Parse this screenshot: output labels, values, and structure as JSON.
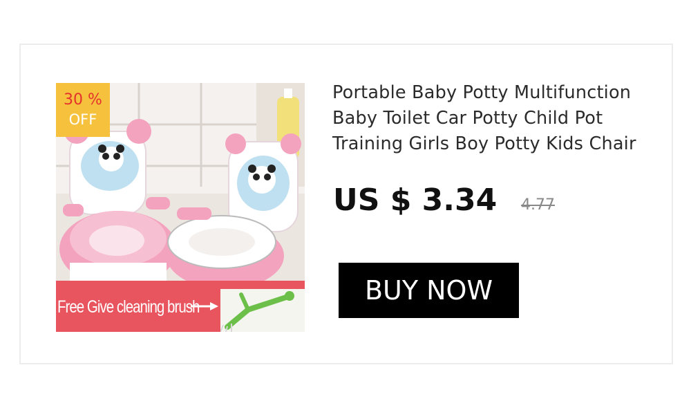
{
  "product": {
    "title": "Portable Baby Potty Multifunction Baby Toilet Car Potty Child Pot Training Girls Boy Potty Kids Chair",
    "price": "US $ 3.34",
    "original_price": "4.77",
    "buy_label": "BUY NOW",
    "badge": {
      "percent": "30 %",
      "off": "OFF"
    },
    "promo_text": "Free Give cleaning brush"
  },
  "colors": {
    "badge_bg": "#f6c23e",
    "badge_percent": "#e4322b",
    "promo_bg": "#e8555f",
    "potty_pink": "#f4a3bf",
    "button_bg": "#000000"
  },
  "icons": [
    "panda-icon",
    "arrow-right-icon",
    "cleaning-brush-icon"
  ]
}
